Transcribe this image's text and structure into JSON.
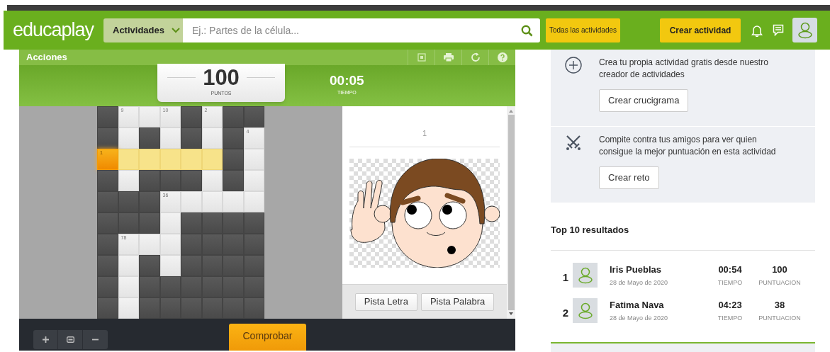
{
  "header": {
    "logo": "**educa**play",
    "category_dropdown": {
      "label": "Actividades"
    },
    "search": {
      "placeholder": "Ej.: Partes de la célula..."
    },
    "all_activities_button": "Todas las actividades",
    "create_button": "Crear actividad"
  },
  "game": {
    "actions_label": "Acciones",
    "score": {
      "value": "100",
      "label": "PUNTOS"
    },
    "timer": {
      "value": "00:05",
      "label": "TIEMPO"
    },
    "grid": [
      [
        {
          "kind": "block"
        },
        {
          "kind": "open",
          "number": "9"
        },
        {
          "kind": "open"
        },
        {
          "kind": "open",
          "number": "10"
        },
        {
          "kind": "block"
        },
        {
          "kind": "open",
          "number": "2"
        },
        {
          "kind": "block"
        },
        {
          "kind": "block"
        }
      ],
      [
        {
          "kind": "block"
        },
        {
          "kind": "open"
        },
        {
          "kind": "block"
        },
        {
          "kind": "open"
        },
        {
          "kind": "block"
        },
        {
          "kind": "open"
        },
        {
          "kind": "block"
        },
        {
          "kind": "open",
          "number": "4"
        }
      ],
      [
        {
          "kind": "active",
          "number": "1"
        },
        {
          "kind": "highlight"
        },
        {
          "kind": "highlight"
        },
        {
          "kind": "highlight"
        },
        {
          "kind": "highlight"
        },
        {
          "kind": "highlight"
        },
        {
          "kind": "block"
        },
        {
          "kind": "open"
        }
      ],
      [
        {
          "kind": "block"
        },
        {
          "kind": "open"
        },
        {
          "kind": "block"
        },
        {
          "kind": "block"
        },
        {
          "kind": "block"
        },
        {
          "kind": "open"
        },
        {
          "kind": "block"
        },
        {
          "kind": "open"
        }
      ],
      [
        {
          "kind": "block"
        },
        {
          "kind": "block"
        },
        {
          "kind": "block"
        },
        {
          "kind": "open",
          "number": "36"
        },
        {
          "kind": "open"
        },
        {
          "kind": "open"
        },
        {
          "kind": "open"
        },
        {
          "kind": "open"
        }
      ],
      [
        {
          "kind": "block"
        },
        {
          "kind": "block"
        },
        {
          "kind": "block"
        },
        {
          "kind": "open"
        },
        {
          "kind": "block"
        },
        {
          "kind": "block"
        },
        {
          "kind": "block"
        },
        {
          "kind": "block"
        }
      ],
      [
        {
          "kind": "block"
        },
        {
          "kind": "open",
          "number": "78"
        },
        {
          "kind": "open"
        },
        {
          "kind": "open"
        },
        {
          "kind": "block"
        },
        {
          "kind": "block"
        },
        {
          "kind": "block"
        },
        {
          "kind": "block"
        }
      ],
      [
        {
          "kind": "block"
        },
        {
          "kind": "open"
        },
        {
          "kind": "block"
        },
        {
          "kind": "open"
        },
        {
          "kind": "block"
        },
        {
          "kind": "block"
        },
        {
          "kind": "block"
        },
        {
          "kind": "block"
        }
      ],
      [
        {
          "kind": "block"
        },
        {
          "kind": "open"
        },
        {
          "kind": "block"
        },
        {
          "kind": "block"
        },
        {
          "kind": "block"
        },
        {
          "kind": "block"
        },
        {
          "kind": "block"
        },
        {
          "kind": "block"
        }
      ],
      [
        {
          "kind": "block"
        },
        {
          "kind": "open"
        },
        {
          "kind": "block"
        },
        {
          "kind": "block"
        },
        {
          "kind": "block"
        },
        {
          "kind": "block"
        },
        {
          "kind": "block"
        },
        {
          "kind": "block"
        }
      ]
    ],
    "clue": {
      "number": "1"
    },
    "hint_buttons": [
      "Pista Letra",
      "Pista Palabra"
    ],
    "check_button": "Comprobar"
  },
  "sidebar": {
    "promos": [
      {
        "kind": "create",
        "text": "Crea tu propia actividad gratis desde nuestro creador de actividades",
        "button": "Crear crucigrama"
      },
      {
        "kind": "challenge",
        "text": "Compite contra tus amigos para ver quien consigue la mejor puntuación en esta actividad",
        "button": "Crear reto"
      }
    ],
    "results_title": "Top 10 resultados",
    "results": [
      {
        "rank": "1",
        "name": "Iris Pueblas",
        "date": "28 de Mayo de 2020",
        "time": "00:54",
        "time_label": "TIEMPO",
        "score": "100",
        "score_label": "PUNTUACION"
      },
      {
        "rank": "2",
        "name": "Fatima Nava",
        "date": "28 de Mayo de 2020",
        "time": "04:23",
        "time_label": "TIEMPO",
        "score": "38",
        "score_label": "PUNTUACION"
      }
    ]
  }
}
